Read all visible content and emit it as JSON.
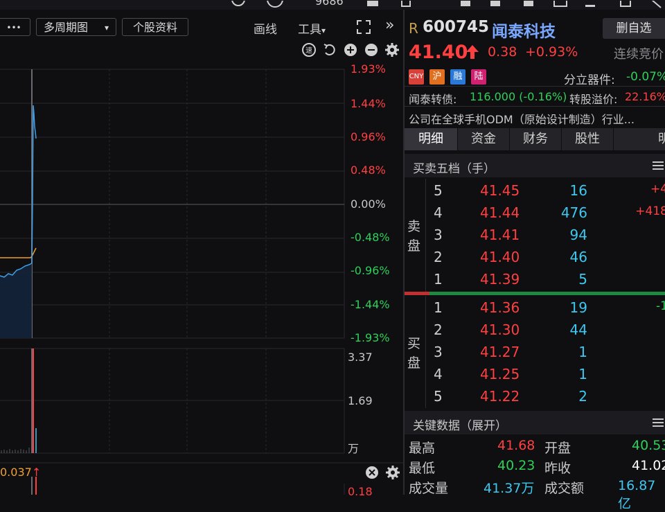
{
  "topbar": {
    "fragment": "9686"
  },
  "toolbar": {
    "more_label": "•••",
    "multi_period_label": "多周期图",
    "stock_info_label": "个股资料",
    "draw_label": "画线",
    "tools_label": "工具",
    "expand_label": "»"
  },
  "chart": {
    "pct_labels": [
      "1.93%",
      "1.44%",
      "0.96%",
      "0.48%",
      "0.00%",
      "-0.48%",
      "-0.96%",
      "-1.44%",
      "-1.93%"
    ],
    "vol_labels": [
      "3.37",
      "1.69",
      "万"
    ],
    "sub_value": "0.037",
    "sub_axis": "0.18"
  },
  "stock": {
    "r_flag": "R",
    "code": "600745",
    "name": "闻泰科技",
    "delete_label": "删自选",
    "price": "41.40",
    "change": "0.38",
    "change_pct": "+0.93%",
    "status": "连续竞价",
    "badges": [
      "CNY",
      "沪",
      "融",
      "陆"
    ],
    "sector": "分立器件:",
    "sector_pct": "-0.07%",
    "bond_label": "闻泰转债:",
    "bond_value": "116.000 (-0.16%)",
    "premium_label": "转股溢价:",
    "premium_value": "22.16%",
    "description": "公司在全球手机ODM（原始设计制造）行业..."
  },
  "tabs": [
    "明细",
    "资金",
    "财务",
    "股性",
    "明"
  ],
  "orderbook": {
    "title": "买卖五档（手）",
    "sell_label": [
      "卖",
      "盘"
    ],
    "buy_label": [
      "买",
      "盘"
    ],
    "sell": [
      {
        "level": "5",
        "price": "41.45",
        "vol": "16",
        "chg": "+4"
      },
      {
        "level": "4",
        "price": "41.44",
        "vol": "476",
        "chg": "+418"
      },
      {
        "level": "3",
        "price": "41.41",
        "vol": "94",
        "chg": ""
      },
      {
        "level": "2",
        "price": "41.40",
        "vol": "46",
        "chg": ""
      },
      {
        "level": "1",
        "price": "41.39",
        "vol": "5",
        "chg": ""
      }
    ],
    "buy": [
      {
        "level": "1",
        "price": "41.36",
        "vol": "19",
        "chg": "-1"
      },
      {
        "level": "2",
        "price": "41.30",
        "vol": "44",
        "chg": ""
      },
      {
        "level": "3",
        "price": "41.27",
        "vol": "1",
        "chg": ""
      },
      {
        "level": "4",
        "price": "41.25",
        "vol": "1",
        "chg": ""
      },
      {
        "level": "5",
        "price": "41.22",
        "vol": "2",
        "chg": ""
      }
    ]
  },
  "keydata": {
    "title": "关键数据（展开）",
    "high_label": "最高",
    "high": "41.68",
    "open_label": "开盘",
    "open": "40.53",
    "low_label": "最低",
    "low": "40.23",
    "prev_label": "昨收",
    "prev": "41.02",
    "volume_label": "成交量",
    "volume": "41.37万",
    "amount_label": "成交额",
    "amount": "16.87亿"
  },
  "colors": {
    "up": "#ff4040",
    "down": "#2fd05a",
    "accent": "#3ec8f0",
    "avg": "#f0a030"
  }
}
